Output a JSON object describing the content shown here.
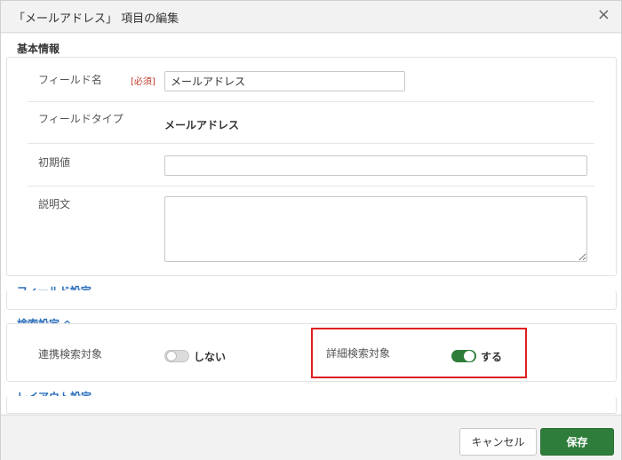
{
  "header": {
    "title": "「メールアドレス」 項目の編集",
    "close": "×"
  },
  "basic": {
    "title": "基本情報",
    "field_name_label": "フィールド名",
    "required": "[必須]",
    "field_name_value": "メールアドレス",
    "field_type_label": "フィールドタイプ",
    "field_type_value": "メールアドレス",
    "default_label": "初期値",
    "default_value": "",
    "description_label": "説明文",
    "description_value": ""
  },
  "field_settings": {
    "title": "フィールド設定",
    "chevron": "⌄",
    "expanded": false
  },
  "search_settings": {
    "title": "検索設定",
    "chevron": "^",
    "expanded": true,
    "linked_label": "連携検索対象",
    "linked_value": "しない",
    "linked_on": false,
    "detail_label": "詳細検索対象",
    "detail_value": "する",
    "detail_on": true
  },
  "layout_settings": {
    "title": "レイアウト設定",
    "chevron": "⌄",
    "expanded": false
  },
  "footer": {
    "cancel": "キャンセル",
    "save": "保存"
  },
  "colors": {
    "accent": "#2e7d3a",
    "link": "#2a6ebb",
    "required": "#c0392b",
    "highlight": "#e02020"
  }
}
